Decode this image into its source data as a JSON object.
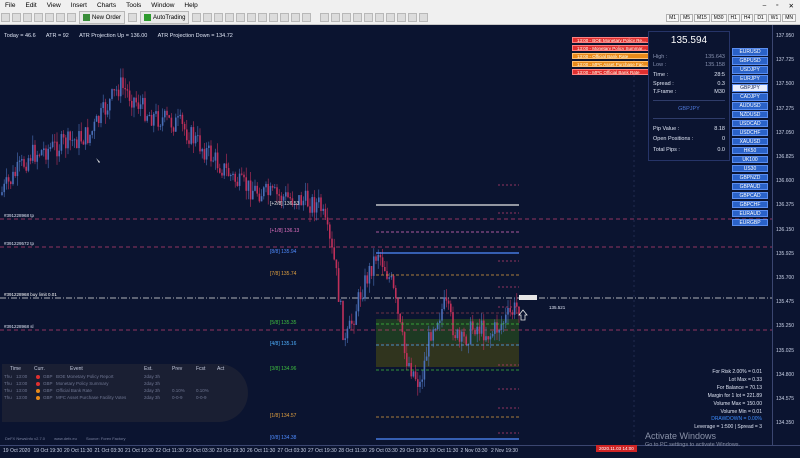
{
  "menu": [
    "File",
    "Edit",
    "View",
    "Insert",
    "Charts",
    "Tools",
    "Window",
    "Help"
  ],
  "toolbar": {
    "new_order": "New Order",
    "autotrading": "AutoTrading",
    "timeframes": [
      "M1",
      "M5",
      "M15",
      "M30",
      "H1",
      "H4",
      "D1",
      "W1",
      "MN"
    ]
  },
  "header_info": {
    "today": "Today = 46.6",
    "atr": "ATR = 92",
    "atr_up": "ATR Projection Up = 136.00",
    "atr_down": "ATR Projection Down = 134.72"
  },
  "news": [
    {
      "text": "13:00 - BOE Monetary Policy Re...",
      "color": "#e03030"
    },
    {
      "text": "13:00 - Monetary Policy Summar...",
      "color": "#e03030"
    },
    {
      "text": "13:00 - Official Bank Rate",
      "color": "#e88a1a"
    },
    {
      "text": "13:00 - MPC Asset Purchase Fac...",
      "color": "#e88a1a"
    },
    {
      "text": "13:00 - MPC Official Bank Rate",
      "color": "#e03030"
    }
  ],
  "panel": {
    "price": "135.594",
    "high_label": "High :",
    "high": "135.643",
    "low_label": "Low :",
    "low": "135.158",
    "time_label": "Time :",
    "time": "28:5",
    "spread_label": "Spread :",
    "spread": "0.3",
    "tf_label": "T.Frame :",
    "tf": "M30",
    "symbol": "GBPJPY",
    "pip_label": "Pip Value :",
    "pip": "8.18",
    "open_label": "Open Positions :",
    "open": "0",
    "total_label": "Total Pips :",
    "total": "0.0"
  },
  "pairs": [
    "EURUSD",
    "GBPUSD",
    "USDJPY",
    "EURJPY",
    "GBPJPY",
    "CADJPY",
    "AUDUSD",
    "NZDUSD",
    "USDCAD",
    "USDCHF",
    "XAUUSD",
    "HK50",
    "UK100",
    "US30",
    "GBPNZD",
    "GBPAUD",
    "GBPCAD",
    "GBPCHF",
    "EURAUD",
    "EURGBP"
  ],
  "active_pair": "GBPJPY",
  "stats": [
    "For Risk 2.00% = 0.01",
    "Lot Max = 0.33",
    "For Balance = 70.13",
    "Margin for 1 lot = 221.89",
    "Volume Max = 150.00",
    "Volume Min = 0.01",
    "DRAWDOWN = 0.00%",
    "Leverage = 1:500 | Spread = 3"
  ],
  "calendar": {
    "headers": [
      "Time",
      "Curr.",
      "Event",
      "Est.",
      "Prev",
      "Fcst",
      "Act"
    ],
    "rows": [
      {
        "day": "Thu",
        "time": "13:00",
        "dot": "#e03030",
        "cur": "GBP",
        "event": "BOE Monetary Policy Report",
        "est": "2day 3h",
        "prev": "",
        "fcst": ""
      },
      {
        "day": "Thu",
        "time": "13:00",
        "dot": "#e03030",
        "cur": "GBP",
        "event": "Monetary Policy Summary",
        "est": "2day 3h",
        "prev": "",
        "fcst": ""
      },
      {
        "day": "Thu",
        "time": "13:00",
        "dot": "#e88a1a",
        "cur": "GBP",
        "event": "Official Bank Rate",
        "est": "2day 3h",
        "prev": "0.10%",
        "fcst": "0.10%"
      },
      {
        "day": "Thu",
        "time": "13:00",
        "dot": "#e88a1a",
        "cur": "GBP",
        "event": "MPC Asset Purchase Facility Votes",
        "est": "2day 3h",
        "prev": "0-0-9",
        "fcst": "0-0-9"
      }
    ]
  },
  "footer": [
    "DeFX NewsInfo v2.7.0",
    "www.defx.eu",
    "Source: Forex Factory"
  ],
  "levels": [
    {
      "label": "[+2/8]",
      "value": "136.53",
      "color": "#e6e6e6"
    },
    {
      "label": "[+1/8]",
      "value": "136.13",
      "color": "#e070c0"
    },
    {
      "label": "[8/8]",
      "value": "135.94",
      "color": "#4f8cff"
    },
    {
      "label": "[7/8]",
      "value": "135.74",
      "color": "#e0a040"
    },
    {
      "label": "[5/8]",
      "value": "135.35",
      "color": "#3fbf3f"
    },
    {
      "label": "[4/8]",
      "value": "135.16",
      "color": "#4fb0ff"
    },
    {
      "label": "[3/8]",
      "value": "134.96",
      "color": "#3fbf3f"
    },
    {
      "label": "[1/8]",
      "value": "134.57",
      "color": "#e0a040"
    },
    {
      "label": "[0/8]",
      "value": "134.38",
      "color": "#4f8cff"
    }
  ],
  "hlines": [
    {
      "label": "#391228968 tp",
      "color": "#c04070"
    },
    {
      "label": "#391229572 tp",
      "color": "#c04070"
    },
    {
      "label": "#391228968 buy limit 0.01",
      "color": "#e6e6e6"
    },
    {
      "label": "#391228968 sl",
      "color": "#c04070"
    }
  ],
  "price_marker": "135.521",
  "yaxis": [
    "137.950",
    "137.725",
    "137.500",
    "137.275",
    "137.050",
    "136.825",
    "136.600",
    "136.375",
    "136.150",
    "135.925",
    "135.700",
    "135.475",
    "135.250",
    "135.025",
    "134.800",
    "134.575",
    "134.350"
  ],
  "xaxis": [
    "19 Oct 2020",
    "19 Oct 19:30",
    "20 Oct 11:30",
    "21 Oct 03:30",
    "21 Oct 19:30",
    "22 Oct 11:30",
    "23 Oct 03:30",
    "23 Oct 19:30",
    "26 Oct 11:30",
    "27 Oct 03:30",
    "27 Oct 19:30",
    "28 Oct 11:30",
    "29 Oct 03:30",
    "29 Oct 19:30",
    "30 Oct 11:30",
    "2 Nov 03:30",
    "2 Nov 19:30"
  ],
  "stamp": "2020.11.03 14:00",
  "activate": {
    "title": "Activate Windows",
    "sub": "Go to PC settings to activate Windows."
  },
  "colors": {
    "bg": "#0b1430",
    "bull": "#4a6fb8",
    "bear": "#c0305a"
  }
}
